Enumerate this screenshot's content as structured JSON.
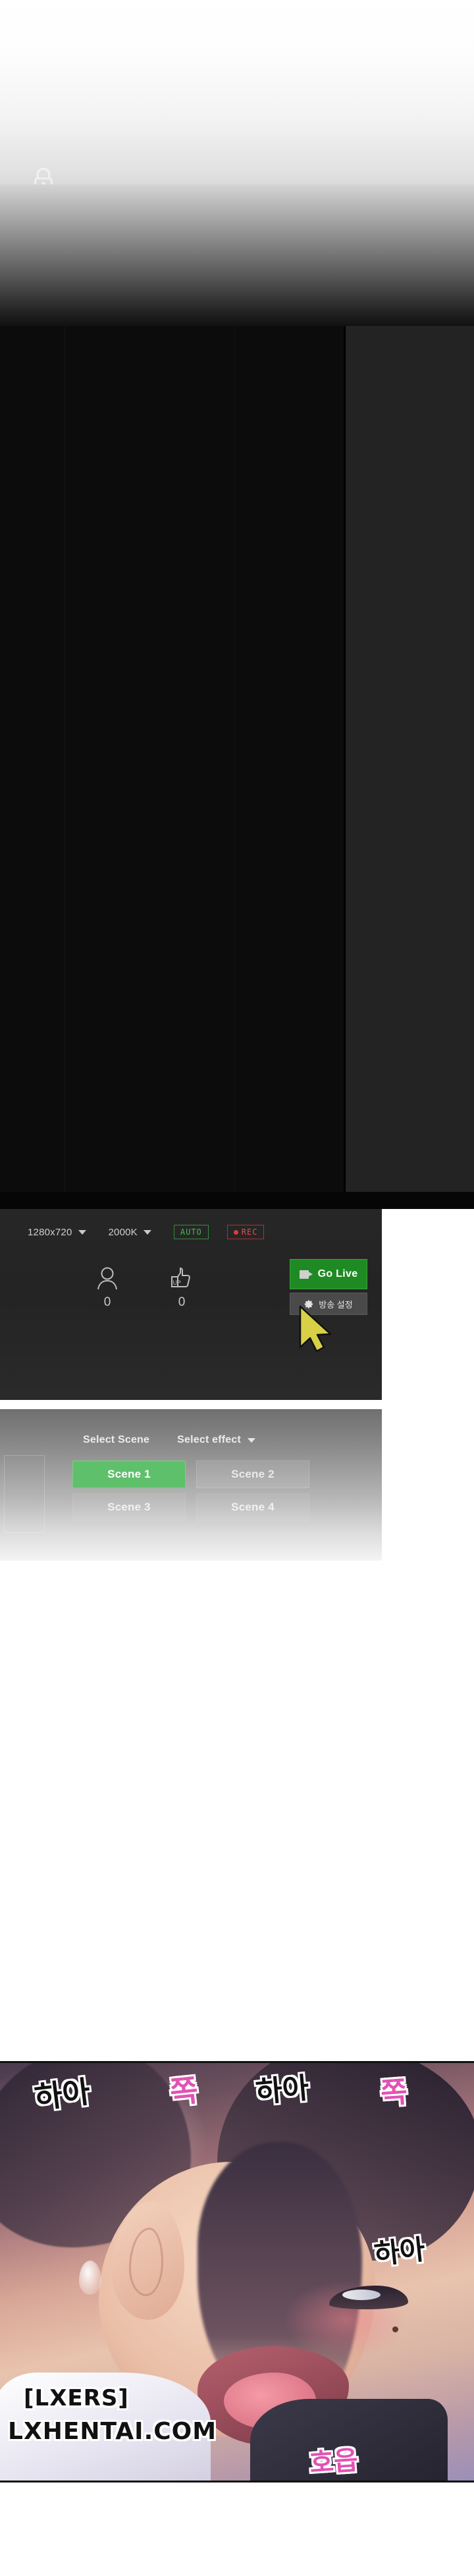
{
  "watermark": {
    "lock_icon": "lock-icon",
    "tag": "[LXERS]",
    "site": "LXHENTAI.COM"
  },
  "broadcast_app": {
    "settings_bar": {
      "resolution": "1280x720",
      "resolution_caret": "chevron-down-icon",
      "bitrate": "2000K",
      "bitrate_caret": "chevron-down-icon",
      "auto_badge": "AUTO",
      "rec_badge": "REC",
      "rec_dot": "record-dot-icon"
    },
    "stats": [
      {
        "icon": "viewer-person-icon",
        "label": "viewers",
        "value": "0"
      },
      {
        "icon": "thumbs-up-icon",
        "label": "likes",
        "value": "0"
      }
    ],
    "go_live": {
      "label": "Go Live",
      "icon": "video-camera-icon"
    },
    "broadcast_settings": {
      "label": "방송 설정",
      "icon": "gear-icon"
    },
    "cursor": "mouse-pointer-icon"
  },
  "scene_panel": {
    "select_scene_label": "Select Scene",
    "select_effect_label": "Select effect",
    "effect_caret": "chevron-down-icon",
    "scenes": [
      {
        "label": "Scene 1",
        "active": true
      },
      {
        "label": "Scene 2",
        "active": false
      },
      {
        "label": "Scene 3",
        "active": false
      },
      {
        "label": "Scene 4",
        "active": false
      }
    ]
  },
  "comic_panel": {
    "sound_effects": [
      {
        "text": "하아",
        "color": "#111111",
        "style": "black"
      },
      {
        "text": "쪽",
        "color": "#e252b4",
        "style": "pink"
      },
      {
        "text": "하아",
        "color": "#111111",
        "style": "black"
      },
      {
        "text": "쪽",
        "color": "#e252b4",
        "style": "pink"
      },
      {
        "text": "하아",
        "color": "#111111",
        "style": "black"
      },
      {
        "text": "호읍",
        "color": "#e252b4",
        "style": "pink"
      }
    ]
  },
  "colors": {
    "accent_green": "#1f8a23",
    "scene_active_green": "#5fc06b",
    "auto_green": "#3fbf4c",
    "rec_red": "#e05050",
    "cursor_yellow": "#d8d045",
    "sfx_pink": "#e252b4"
  }
}
